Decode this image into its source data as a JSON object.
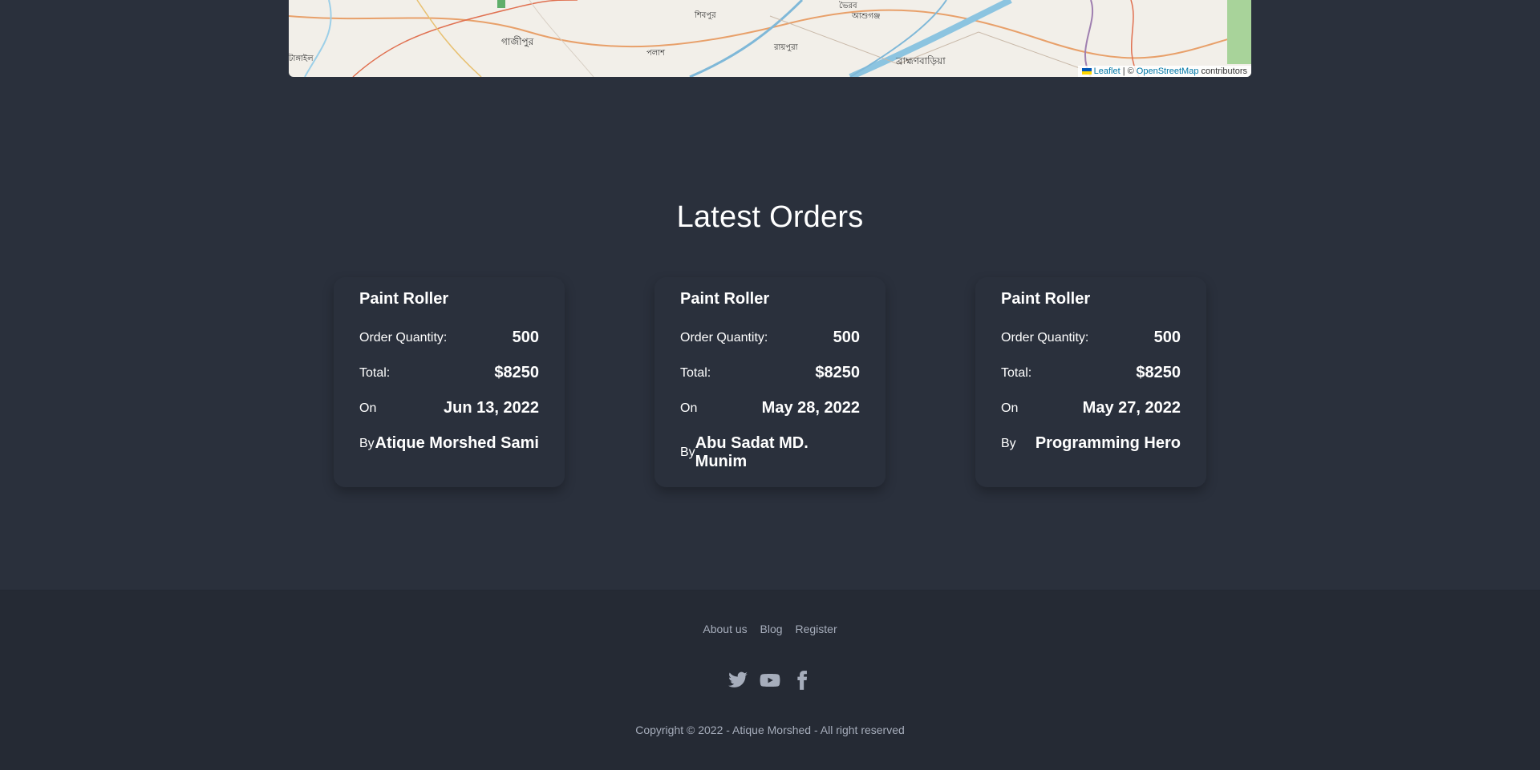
{
  "map": {
    "labels": [
      "গাজীপুর",
      "শিবপুর",
      "পলাশ",
      "রায়পুরা",
      "আশুগঞ্জ",
      "ভৈরব",
      "ব্রাহ্মণবাড়িয়া",
      "টাঙ্গাইল"
    ],
    "attribution": {
      "leaflet": "Leaflet",
      "sep": "| ©",
      "osm": "OpenStreetMap",
      "suffix": "contributors"
    }
  },
  "section": {
    "title": "Latest Orders"
  },
  "labels": {
    "quantity": "Order Quantity:",
    "total": "Total:",
    "on": "On",
    "by": "By"
  },
  "orders": [
    {
      "product": "Paint Roller",
      "quantity": "500",
      "total": "$8250",
      "date": "Jun 13, 2022",
      "by": "Atique Morshed Sami"
    },
    {
      "product": "Paint Roller",
      "quantity": "500",
      "total": "$8250",
      "date": "May 28, 2022",
      "by": "Abu Sadat MD. Munim"
    },
    {
      "product": "Paint Roller",
      "quantity": "500",
      "total": "$8250",
      "date": "May 27, 2022",
      "by": "Programming Hero"
    }
  ],
  "footer": {
    "links": [
      "About us",
      "Blog",
      "Register"
    ],
    "social_icons": [
      "twitter-icon",
      "youtube-icon",
      "facebook-icon"
    ],
    "copyright": "Copyright © 2022 - Atique Morshed - All right reserved"
  },
  "colors": {
    "background": "#2a303c",
    "footer": "#252a34",
    "muted_text": "#a6adbb",
    "link": "#0078a8"
  }
}
